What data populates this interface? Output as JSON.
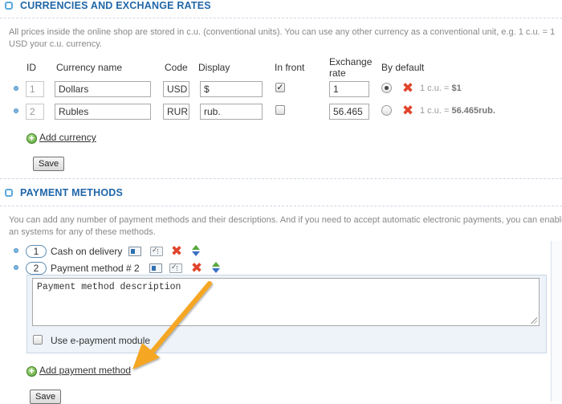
{
  "currencies": {
    "title": "CURRENCIES AND EXCHANGE RATES",
    "description": "All prices inside the online shop are stored in c.u. (conventional units). You can use any other currency as a conventional unit, e.g. 1 c.u. = 1 USD your c.u. currency.",
    "headers": {
      "id": "ID",
      "name": "Currency name",
      "code": "Code",
      "display": "Display",
      "in_front": "In front",
      "exchange_rate": "Exchange rate",
      "by_default": "By default"
    },
    "rows": [
      {
        "id": "1",
        "name": "Dollars",
        "code": "USD",
        "display": "$",
        "in_front": true,
        "rate": "1",
        "is_default": true,
        "summary_prefix": "1 c.u. = ",
        "summary_value": "$1"
      },
      {
        "id": "2",
        "name": "Rubles",
        "code": "RUR",
        "display": "rub.",
        "in_front": false,
        "rate": "56.465",
        "is_default": false,
        "summary_prefix": "1 c.u. = ",
        "summary_value": "56.465rub."
      }
    ],
    "add_label": "Add currency",
    "save_label": "Save"
  },
  "payment": {
    "title": "PAYMENT METHODS",
    "description": "You can add any number of payment methods and their descriptions. And if you need to accept automatic electronic payments, you can enable an systems for any of these methods.",
    "methods": [
      {
        "num": "1",
        "name": "Cash on delivery"
      },
      {
        "num": "2",
        "name": "Payment method # 2"
      }
    ],
    "description_placeholder": "Payment method description",
    "epayment_label": "Use e-payment module",
    "epayment_checked": false,
    "add_label": "Add payment method",
    "save_label": "Save"
  },
  "colors": {
    "section_title": "#1f66a8",
    "annotation_arrow": "#f5a623",
    "delete_icon": "#e0442c"
  },
  "icons": {
    "section": "collapse-square-icon",
    "drag": "drag-dot-icon",
    "delete": "red-x-icon",
    "move": "up-down-arrows-icon",
    "add": "green-plus-icon"
  }
}
